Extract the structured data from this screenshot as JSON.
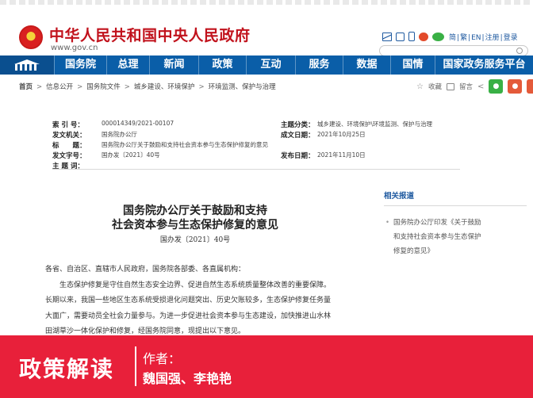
{
  "header": {
    "site_title": "中华人民共和国中央人民政府",
    "site_url": "www.gov.cn",
    "lang_links": [
      "简",
      "繁",
      "EN",
      "注册",
      "登录"
    ]
  },
  "nav": {
    "items": [
      "国务院",
      "总理",
      "新闻",
      "政策",
      "互动",
      "服务",
      "数据",
      "国情",
      "国家政务服务平台"
    ]
  },
  "breadcrumb": {
    "items": [
      "首页",
      "信息公开",
      "国务院文件",
      "城乡建设、环境保护",
      "环境监测、保护与治理"
    ]
  },
  "share": {
    "favorite_label": "收藏",
    "print_label": "留言"
  },
  "meta": {
    "index_label": "索 引 号：",
    "index_value": "000014349/2021-00107",
    "agency_label": "发文机关：",
    "agency_value": "国务院办公厅",
    "title_label": "标　　题：",
    "title_value": "国务院办公厅关于鼓励和支持社会资本参与生态保护修复的意见",
    "doc_no_label": "发文字号：",
    "doc_no_value": "国办发〔2021〕40号",
    "subject_label": "主 题 词：",
    "subject_value": "",
    "category_label": "主题分类：",
    "category_value": "城乡建设、环境保护\\环境监测、保护与治理",
    "date_written_label": "成文日期：",
    "date_written_value": "2021年10月25日",
    "date_published_label": "发布日期：",
    "date_published_value": "2021年11月10日"
  },
  "document": {
    "title_line1": "国务院办公厅关于鼓励和支持",
    "title_line2": "社会资本参与生态保护修复的意见",
    "number": "国办发〔2021〕40号",
    "salutation": "各省、自治区、直辖市人民政府，国务院各部委、各直属机构：",
    "paragraph_lines": [
      "生态保护修复是守住自然生态安全边界、促进自然生态系统质量整体改善的重要保障。",
      "长期以来，我国一些地区生态系统受损退化问题突出、历史欠账较多，生态保护修复任务量",
      "大面广，需要动员全社会力量参与。为进一步促进社会资本参与生态建设，加快推进山水林",
      "田湖草沙一体化保护和修复，经国务院同意，现提出以下意见。"
    ]
  },
  "related": {
    "title": "相关报道",
    "items": [
      [
        "国务院办公厅印发《关于鼓励",
        "和支持社会资本参与生态保护",
        "修复的意见》"
      ]
    ]
  },
  "banner": {
    "title": "政策解读",
    "author_label": "作者：",
    "author_names": "魏国强、李艳艳",
    "color": "#e8203a"
  }
}
